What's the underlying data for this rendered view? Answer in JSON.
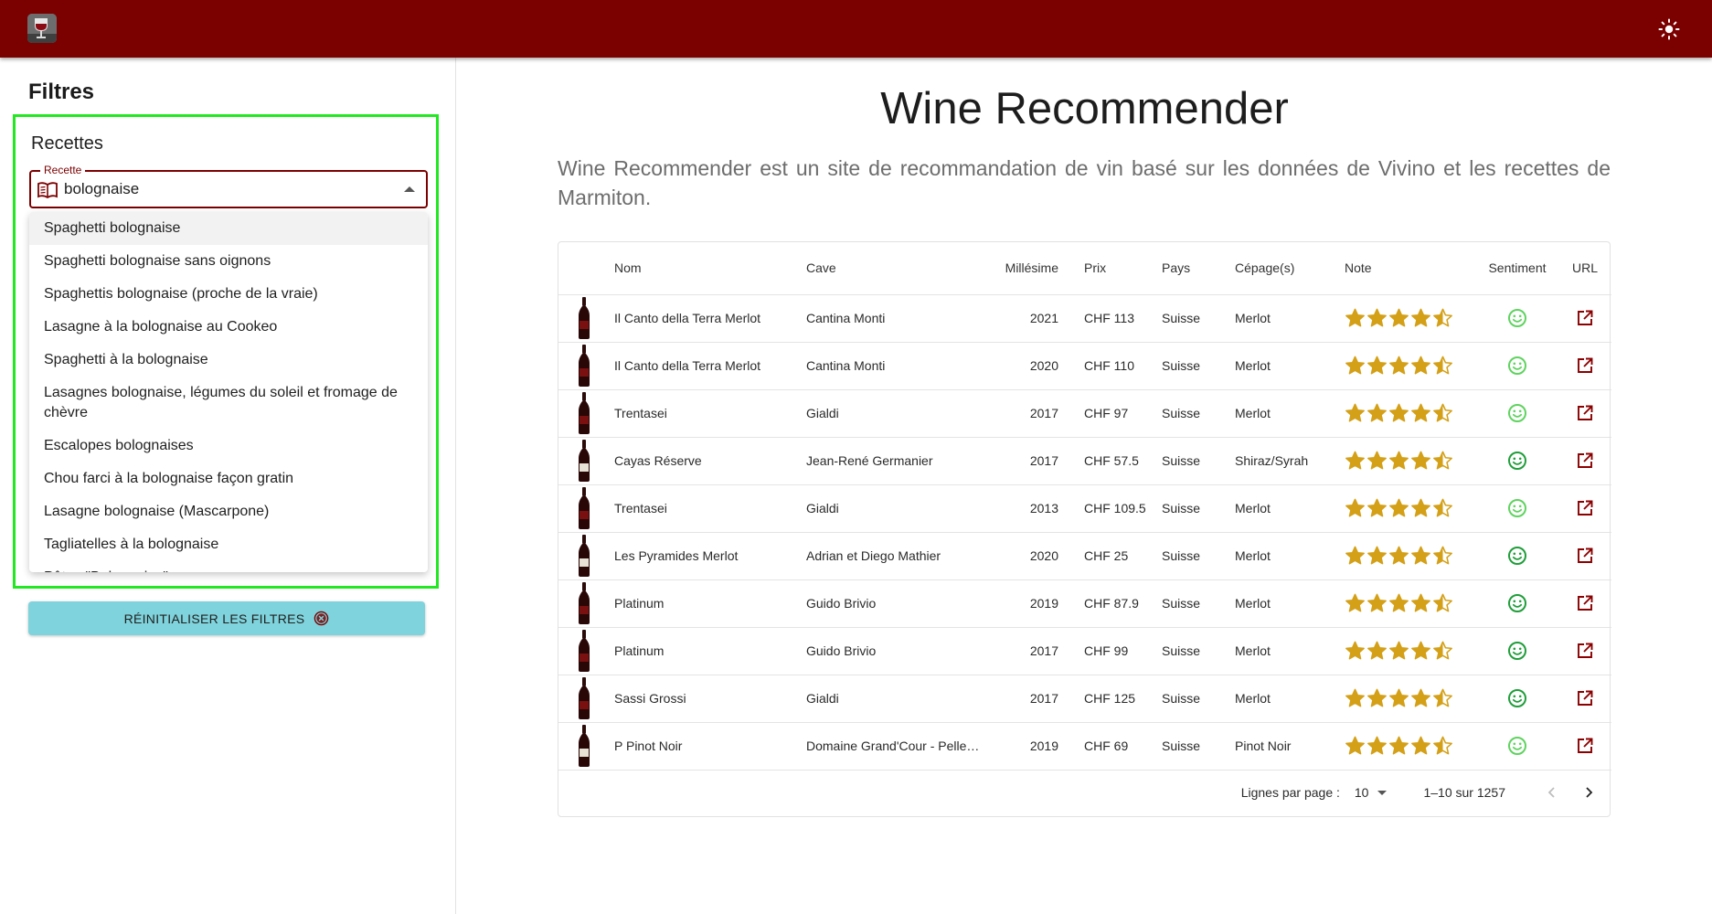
{
  "appbar": {
    "logo_icon": "wine-glass-logo",
    "theme_icon": "sun-icon",
    "color": "#7b0000"
  },
  "sidebar": {
    "filters_title": "Filtres",
    "recipes_title": "Recettes",
    "recipe_field": {
      "label": "Recette",
      "value": "bolognaise",
      "icon": "book-icon"
    },
    "options": [
      "Spaghetti bolognaise",
      "Spaghetti bolognaise sans oignons",
      "Spaghettis bolognaise (proche de la vraie)",
      "Lasagne à la bolognaise au Cookeo",
      "Spaghetti à la bolognaise",
      "Lasagnes bolognaise, légumes du soleil et fromage de chèvre",
      "Escalopes bolognaises",
      "Chou farci à la bolognaise façon gratin",
      "Lasagne bolognaise (Mascarpone)",
      "Tagliatelles à la bolognaise",
      "Pâtes \"Bolognaise\""
    ],
    "reset_button": "RÉINITIALISER LES FILTRES",
    "reset_color": "#7fd3dc"
  },
  "main": {
    "title": "Wine Recommender",
    "description": "Wine Recommender est un site de recommandation de vin basé sur les données de Vivino et les recettes de Marmiton.",
    "table": {
      "headers": [
        "Nom",
        "Cave",
        "Millésime",
        "Prix",
        "Pays",
        "Cépage(s)",
        "Note",
        "Sentiment",
        "URL"
      ],
      "rows": [
        {
          "nom": "Il Canto della Terra Merlot",
          "cave": "Cantina Monti",
          "millesime": "2021",
          "prix": "CHF 113",
          "pays": "Suisse",
          "cepage": "Merlot",
          "note": 4.5,
          "sentiment": "light"
        },
        {
          "nom": "Il Canto della Terra Merlot",
          "cave": "Cantina Monti",
          "millesime": "2020",
          "prix": "CHF 110",
          "pays": "Suisse",
          "cepage": "Merlot",
          "note": 4.5,
          "sentiment": "light"
        },
        {
          "nom": "Trentasei",
          "cave": "Gialdi",
          "millesime": "2017",
          "prix": "CHF 97",
          "pays": "Suisse",
          "cepage": "Merlot",
          "note": 4.5,
          "sentiment": "light"
        },
        {
          "nom": "Cayas Réserve",
          "cave": "Jean-René Germanier",
          "millesime": "2017",
          "prix": "CHF 57.5",
          "pays": "Suisse",
          "cepage": "Shiraz/Syrah",
          "note": 4.5,
          "sentiment": "dark"
        },
        {
          "nom": "Trentasei",
          "cave": "Gialdi",
          "millesime": "2013",
          "prix": "CHF 109.5",
          "pays": "Suisse",
          "cepage": "Merlot",
          "note": 4.5,
          "sentiment": "light"
        },
        {
          "nom": "Les Pyramides Merlot",
          "cave": "Adrian et Diego Mathier",
          "millesime": "2020",
          "prix": "CHF 25",
          "pays": "Suisse",
          "cepage": "Merlot",
          "note": 4.5,
          "sentiment": "dark"
        },
        {
          "nom": "Platinum",
          "cave": "Guido Brivio",
          "millesime": "2019",
          "prix": "CHF 87.9",
          "pays": "Suisse",
          "cepage": "Merlot",
          "note": 4.5,
          "sentiment": "dark"
        },
        {
          "nom": "Platinum",
          "cave": "Guido Brivio",
          "millesime": "2017",
          "prix": "CHF 99",
          "pays": "Suisse",
          "cepage": "Merlot",
          "note": 4.5,
          "sentiment": "dark"
        },
        {
          "nom": "Sassi Grossi",
          "cave": "Gialdi",
          "millesime": "2017",
          "prix": "CHF 125",
          "pays": "Suisse",
          "cepage": "Merlot",
          "note": 4.5,
          "sentiment": "dark"
        },
        {
          "nom": "P Pinot Noir",
          "cave": "Domaine Grand'Cour - Pelle…",
          "millesime": "2019",
          "prix": "CHF 69",
          "pays": "Suisse",
          "cepage": "Pinot Noir",
          "note": 4.5,
          "sentiment": "light"
        }
      ]
    },
    "pagination": {
      "rows_label": "Lignes par page :",
      "rows_value": "10",
      "range": "1–10 sur 1257"
    },
    "colors": {
      "star": "#d4a017",
      "sentiment_light": "#5fd35f",
      "sentiment_dark": "#1f9e3a",
      "link": "#8b0000"
    }
  }
}
